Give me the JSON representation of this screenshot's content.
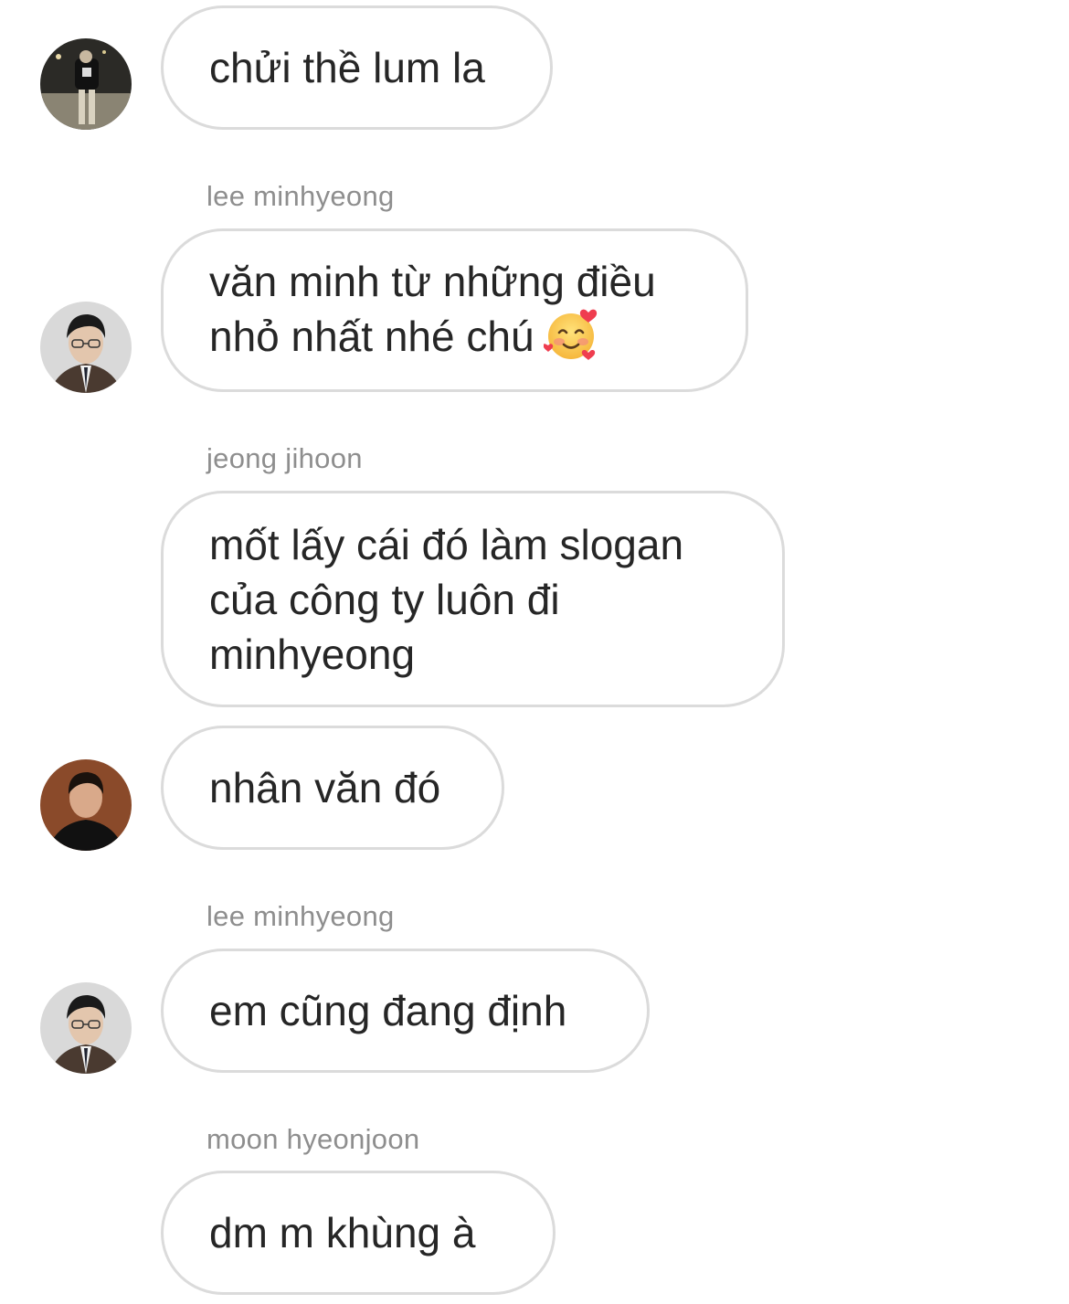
{
  "messages": [
    {
      "sender": "",
      "text": "chửi thề lum la",
      "avatar": "avatar-dark-street-photo"
    },
    {
      "sender": "lee minhyeong",
      "text": "văn minh từ những điều\nnhỏ nhất nhé chú",
      "emoji": "smiling-face-with-hearts-icon",
      "avatar": "avatar-man-glasses-suit"
    },
    {
      "sender": "jeong jihoon",
      "text": "mốt lấy cái đó làm slogan\ncủa công ty luôn đi\nminhyeong"
    },
    {
      "sender": "",
      "text": "nhân văn đó",
      "avatar": "avatar-man-dark-portrait"
    },
    {
      "sender": "lee minhyeong",
      "text": "em cũng đang định",
      "avatar": "avatar-man-glasses-suit"
    },
    {
      "sender": "moon hyeonjoon",
      "text": "dm m khùng à"
    }
  ],
  "colors": {
    "bubble_border": "#dbdbdb",
    "sender_name": "#8e8e8e",
    "message_text": "#262626",
    "background": "#ffffff"
  }
}
